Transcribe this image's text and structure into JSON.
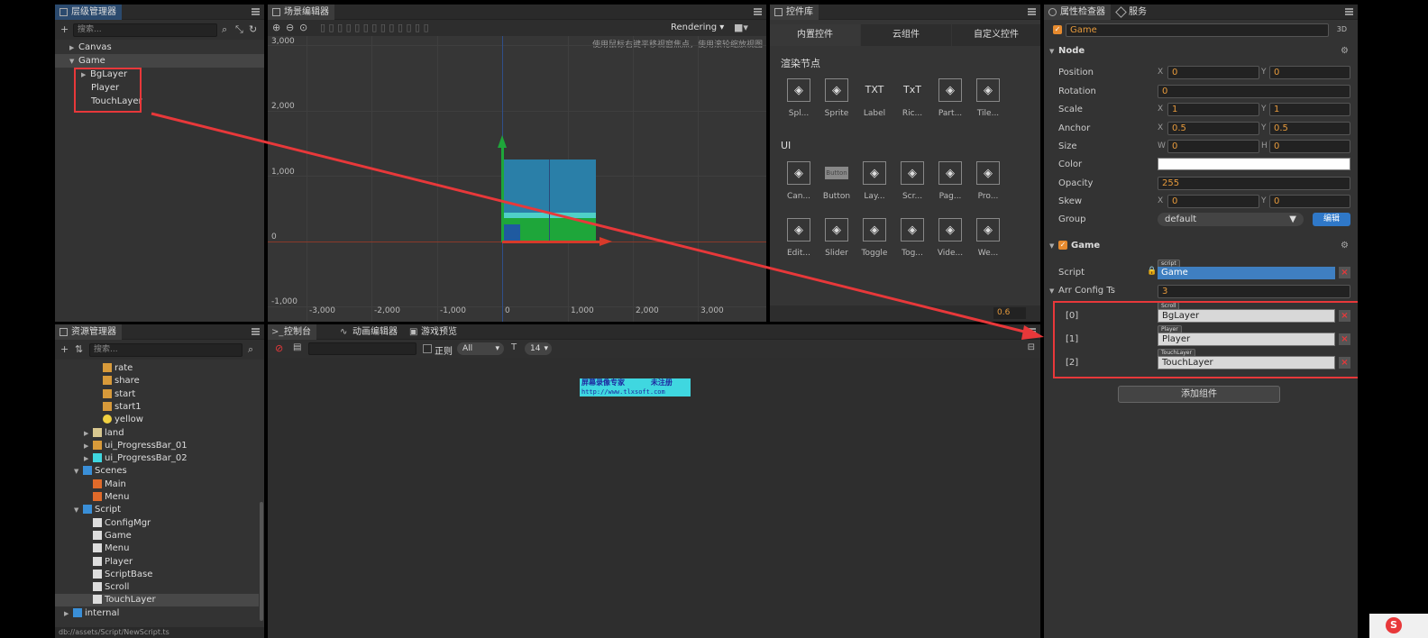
{
  "hierarchy": {
    "title": "层级管理器",
    "search_placeholder": "搜索...",
    "nodes": [
      {
        "label": "Canvas"
      },
      {
        "label": "Game"
      },
      {
        "label": "BgLayer"
      },
      {
        "label": "Player"
      },
      {
        "label": "TouchLayer"
      }
    ]
  },
  "scene": {
    "title": "场景编辑器",
    "hint": "使用鼠标右键平移视窗焦点，使用滚轮缩放视图",
    "rendering_label": "Rendering",
    "y_ticks": [
      "3,000",
      "2,000",
      "1,000",
      "0",
      "-1,000"
    ],
    "x_ticks": [
      "-3,000",
      "-2,000",
      "-1,000",
      "0",
      "1,000",
      "2,000",
      "3,000"
    ],
    "zoom_value": "0.6"
  },
  "controls": {
    "title": "控件库",
    "tabs": [
      "内置控件",
      "云组件",
      "自定义控件"
    ],
    "render_section": "渲染节点",
    "render_items": [
      {
        "label": "Spl...",
        "icon": "sprite-splash-icon"
      },
      {
        "label": "Sprite",
        "icon": "sprite-icon"
      },
      {
        "label": "Label",
        "icon": "label-icon",
        "glyph": "TXT"
      },
      {
        "label": "Ric...",
        "icon": "richtext-icon",
        "glyph": "TxT"
      },
      {
        "label": "Part...",
        "icon": "particle-icon"
      },
      {
        "label": "Tile...",
        "icon": "tiledmap-icon"
      }
    ],
    "ui_section": "UI",
    "ui_items_row1": [
      {
        "label": "Can...",
        "icon": "canvas-icon"
      },
      {
        "label": "Button",
        "icon": "button-icon",
        "glyph": "Button"
      },
      {
        "label": "Lay...",
        "icon": "layout-icon"
      },
      {
        "label": "Scr...",
        "icon": "scrollview-icon"
      },
      {
        "label": "Pag...",
        "icon": "pageview-icon"
      },
      {
        "label": "Pro...",
        "icon": "progressbar-icon"
      }
    ],
    "ui_items_row2": [
      {
        "label": "Edit...",
        "icon": "editbox-icon"
      },
      {
        "label": "Slider",
        "icon": "slider-icon"
      },
      {
        "label": "Toggle",
        "icon": "toggle-icon"
      },
      {
        "label": "Tog...",
        "icon": "togglegroup-icon"
      },
      {
        "label": "Vide...",
        "icon": "videoplayer-icon"
      },
      {
        "label": "We...",
        "icon": "webview-icon"
      }
    ]
  },
  "inspector": {
    "title": "属性检查器",
    "services_tab": "服务",
    "node_name": "Game",
    "three_d_label": "3D",
    "node_section": "Node",
    "position": {
      "label": "Position",
      "x": "0",
      "y": "0"
    },
    "rotation": {
      "label": "Rotation",
      "value": "0"
    },
    "scale": {
      "label": "Scale",
      "x": "1",
      "y": "1"
    },
    "anchor": {
      "label": "Anchor",
      "x": "0.5",
      "y": "0.5"
    },
    "size": {
      "label": "Size",
      "w": "0",
      "h": "0"
    },
    "color": {
      "label": "Color",
      "value": "#ffffff"
    },
    "opacity": {
      "label": "Opacity",
      "value": "255"
    },
    "skew": {
      "label": "Skew",
      "x": "0",
      "y": "0"
    },
    "group": {
      "label": "Group",
      "value": "default",
      "edit_label": "编辑"
    },
    "axis_x": "X",
    "axis_y": "Y",
    "axis_w": "W",
    "axis_h": "H",
    "component_section": "Game",
    "script": {
      "label": "Script",
      "tag": "script",
      "value": "Game"
    },
    "arr_config": {
      "label": "Arr Config Ts",
      "value": "3"
    },
    "entries": [
      {
        "index": "[0]",
        "tag": "Scroll",
        "value": "BgLayer"
      },
      {
        "index": "[1]",
        "tag": "Player",
        "value": "Player"
      },
      {
        "index": "[2]",
        "tag": "TouchLayer",
        "value": "TouchLayer"
      }
    ],
    "add_component_label": "添加组件"
  },
  "assets": {
    "title": "资源管理器",
    "search_placeholder": "搜索...",
    "rows": [
      {
        "label": "rate",
        "indent": 3
      },
      {
        "label": "share",
        "indent": 3
      },
      {
        "label": "start",
        "indent": 3
      },
      {
        "label": "start1",
        "indent": 3
      },
      {
        "label": "yellow",
        "indent": 3
      },
      {
        "label": "land",
        "indent": 2
      },
      {
        "label": "ui_ProgressBar_01",
        "indent": 2
      },
      {
        "label": "ui_ProgressBar_02",
        "indent": 2
      },
      {
        "label": "Scenes",
        "indent": 1
      },
      {
        "label": "Main",
        "indent": 2
      },
      {
        "label": "Menu",
        "indent": 2
      },
      {
        "label": "Script",
        "indent": 1
      },
      {
        "label": "ConfigMgr",
        "indent": 2
      },
      {
        "label": "Game",
        "indent": 2
      },
      {
        "label": "Menu",
        "indent": 2
      },
      {
        "label": "Player",
        "indent": 2
      },
      {
        "label": "ScriptBase",
        "indent": 2
      },
      {
        "label": "Scroll",
        "indent": 2
      },
      {
        "label": "TouchLayer",
        "indent": 2
      },
      {
        "label": "internal",
        "indent": 0
      }
    ],
    "footer_path": "db://assets/Script/NewScript.ts"
  },
  "console": {
    "tabs": [
      "控制台",
      "动画编辑器",
      "游戏预览"
    ],
    "regex_label": "正则",
    "level_value": "All",
    "font_size_value": "14",
    "watermark_line1": "屏幕录像专家      未注册",
    "watermark_line2": "http://www.tlxsoft.com"
  },
  "colors": {
    "accent_orange": "#e68a2e",
    "highlight_red": "#e8383a",
    "script_blue": "#3f7fc1",
    "group_edit_blue": "#2f78c8"
  }
}
